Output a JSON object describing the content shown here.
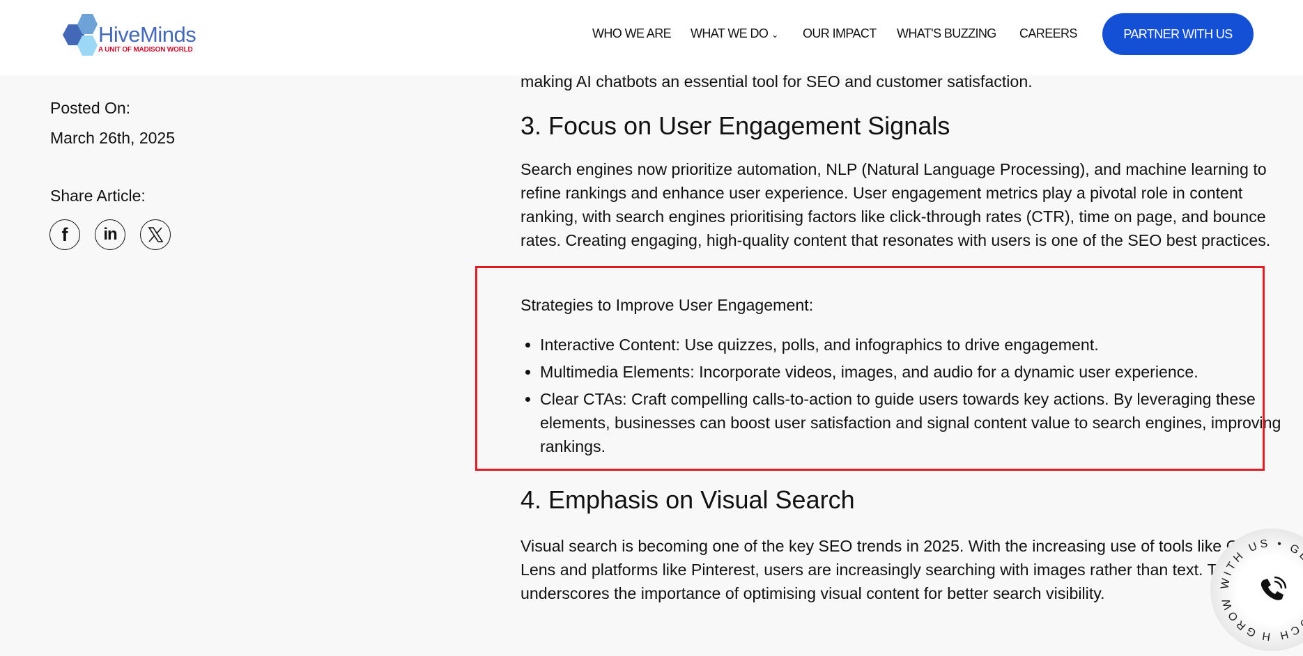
{
  "header": {
    "logo": {
      "name": "HiveMinds",
      "tagline": "A UNIT OF MADISON WORLD",
      "colors": [
        "#4468b8",
        "#6fa3d8",
        "#9bd8f6"
      ]
    },
    "nav": [
      {
        "label": "WHO WE ARE"
      },
      {
        "label": "WHAT WE DO",
        "has_dropdown": true,
        "chevron": "⌄"
      },
      {
        "label": "OUR IMPACT"
      },
      {
        "label": "WHAT'S BUZZING"
      },
      {
        "label": "CAREERS"
      }
    ],
    "cta_label": "PARTNER WITH US",
    "accent": "#1450d6"
  },
  "sidebar": {
    "posted_label": "Posted On:",
    "posted_date": "March 26th, 2025",
    "share_label": "Share Article:",
    "share_icons": [
      "facebook-icon",
      "linkedin-icon",
      "x-icon"
    ]
  },
  "article": {
    "intro_tail": "making AI chatbots an essential tool for SEO and customer satisfaction.",
    "section3": {
      "heading": "3. Focus on User Engagement Signals",
      "paragraph": "Search engines now prioritize automation, NLP (Natural Language Processing), and machine learning to refine rankings and enhance user experience. User engagement metrics play a pivotal role in content ranking, with search engines prioritising factors like click-through rates (CTR), time on page, and bounce rates. Creating engaging, high-quality content that resonates with users is one of the SEO best practices.",
      "strategies_label": "Strategies to Improve User Engagement:",
      "bullets": [
        "Interactive Content: Use quizzes, polls, and infographics to drive engagement.",
        "Multimedia Elements: Incorporate videos, images, and audio for a dynamic user experience.",
        "Clear CTAs: Craft compelling calls-to-action to guide users towards key actions. By leveraging these elements, businesses can boost user satisfaction and signal content value to search engines, improving rankings."
      ]
    },
    "section4": {
      "heading": "4. Emphasis on Visual Search",
      "paragraph": "Visual search is becoming one of the key SEO trends in 2025. With the increasing use of tools like Google Lens and platforms like Pinterest, users are increasingly searching with images rather than text. This shift underscores the importance of optimising visual content for better search visibility."
    },
    "highlight_color": "#e21b23"
  },
  "contact_badge": {
    "ring_text": "GROW WITH US • GET IN TOUCH HERE •",
    "icon": "phone-icon"
  }
}
